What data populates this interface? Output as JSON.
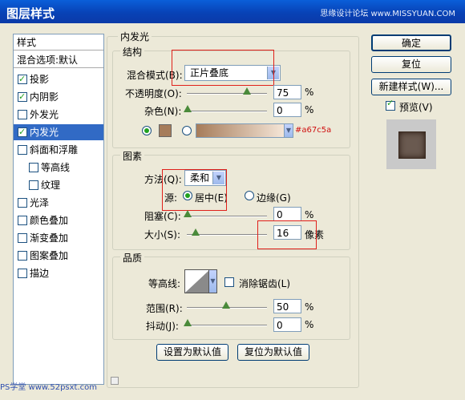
{
  "window": {
    "title": "图层样式",
    "watermark": "思缘设计论坛  www.MISSYUAN.COM"
  },
  "sidebar": {
    "header": "样式",
    "blend": "混合选项:默认",
    "items": [
      {
        "label": "投影",
        "checked": true
      },
      {
        "label": "内阴影",
        "checked": true
      },
      {
        "label": "外发光",
        "checked": false
      },
      {
        "label": "内发光",
        "checked": true,
        "selected": true
      },
      {
        "label": "斜面和浮雕",
        "checked": false
      },
      {
        "label": "等高线",
        "checked": false
      },
      {
        "label": "纹理",
        "checked": false
      },
      {
        "label": "光泽",
        "checked": false
      },
      {
        "label": "颜色叠加",
        "checked": false
      },
      {
        "label": "渐变叠加",
        "checked": false
      },
      {
        "label": "图案叠加",
        "checked": false
      },
      {
        "label": "描边",
        "checked": false
      }
    ]
  },
  "panel": {
    "title": "内发光"
  },
  "structure": {
    "title": "结构",
    "blend_label": "混合模式(B):",
    "blend_value": "正片叠底",
    "opacity_label": "不透明度(O):",
    "opacity_value": "75",
    "noise_label": "杂色(N):",
    "noise_value": "0",
    "pct": "%",
    "color_hex": "#a67c5a",
    "color_text": "#a67c5a"
  },
  "elements": {
    "title": "图素",
    "method_label": "方法(Q):",
    "method_value": "柔和",
    "source_label": "源:",
    "center_label": "居中(E)",
    "edge_label": "边缘(G)",
    "choke_label": "阻塞(C):",
    "choke_value": "0",
    "size_label": "大小(S):",
    "size_value": "16",
    "size_unit": "像素",
    "pct": "%"
  },
  "quality": {
    "title": "品质",
    "contour_label": "等高线:",
    "antialias_label": "消除锯齿(L)",
    "range_label": "范围(R):",
    "range_value": "50",
    "jitter_label": "抖动(J):",
    "jitter_value": "0",
    "pct": "%"
  },
  "buttons": {
    "ok": "确定",
    "reset": "复位",
    "new_style": "新建样式(W)...",
    "preview": "预览(V)",
    "set_default": "设置为默认值",
    "reset_default": "复位为默认值"
  },
  "footer": {
    "watermark": "PS学堂 www.52psxt.com"
  }
}
